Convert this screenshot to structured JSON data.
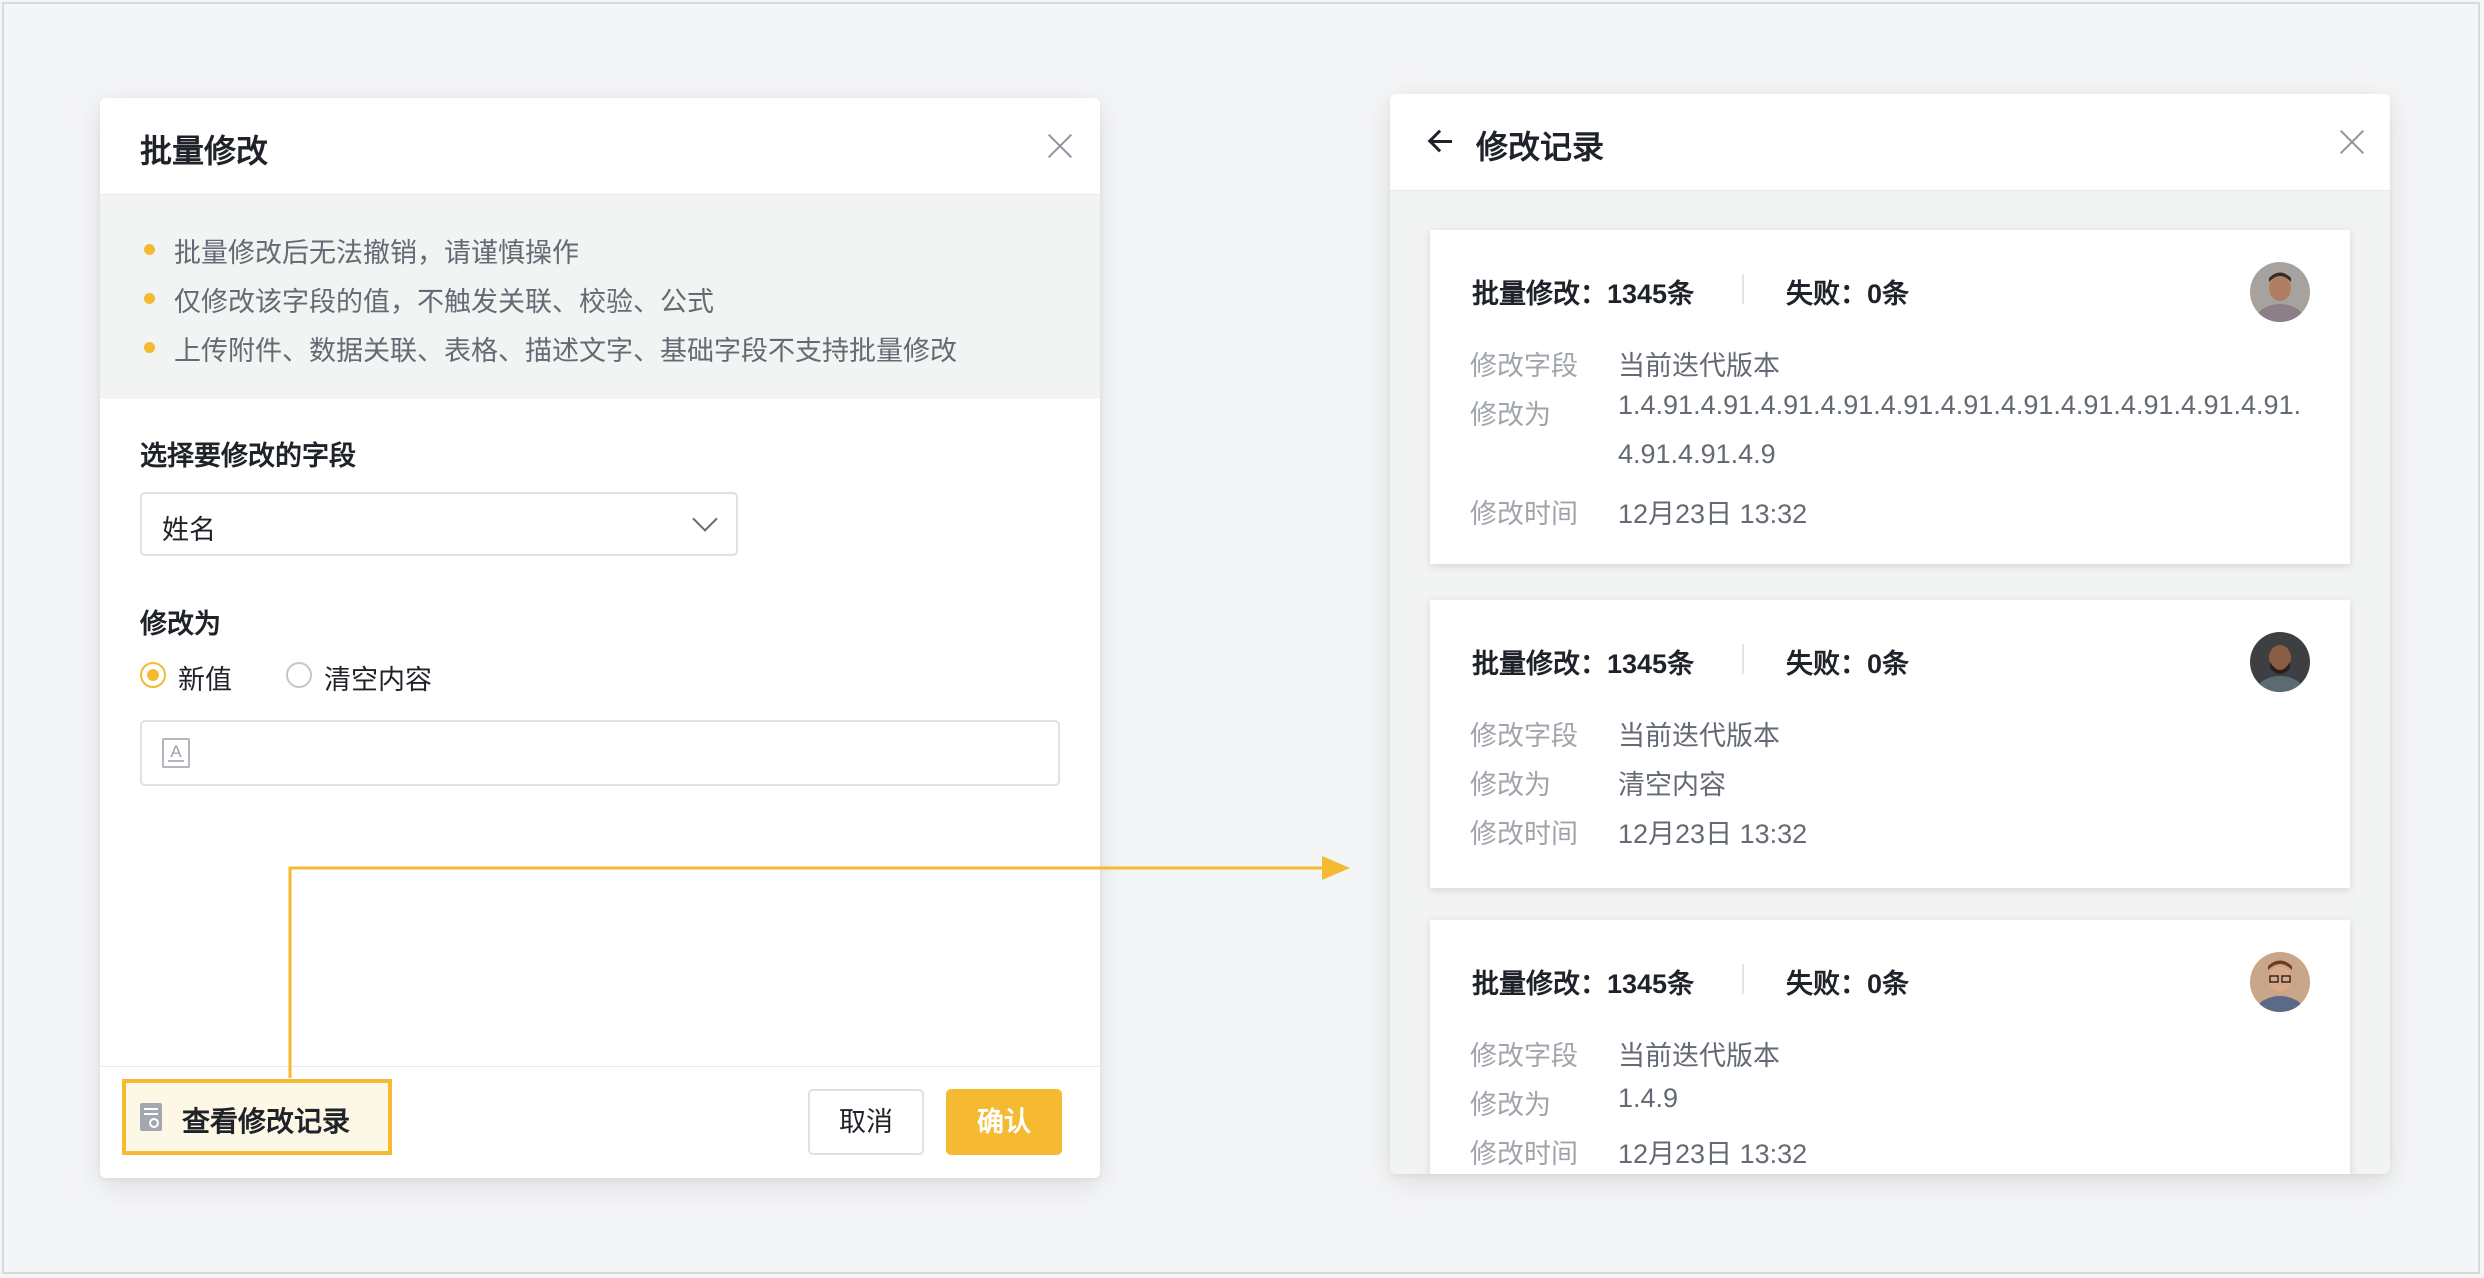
{
  "batch_dialog": {
    "title": "批量修改",
    "tips": [
      "批量修改后无法撤销，请谨慎操作",
      "仅修改该字段的值，不触发关联、校验、公式",
      "上传附件、数据关联、表格、描述文字、基础字段不支持批量修改"
    ],
    "field_label": "选择要修改的字段",
    "field_value": "姓名",
    "modify_to_label": "修改为",
    "options": [
      {
        "label": "新值",
        "checked": true
      },
      {
        "label": "清空内容",
        "checked": false
      }
    ],
    "new_value_input": "",
    "history_button": "查看修改记录",
    "cancel_button": "取消",
    "confirm_button": "确认"
  },
  "history_panel": {
    "title": "修改记录",
    "field_key": "修改字段",
    "value_key": "修改为",
    "time_key": "修改时间",
    "records": [
      {
        "batch": "批量修改：1345条",
        "failed": "失败：0条",
        "field": "当前迭代版本",
        "value": "1.4.91.4.91.4.91.4.91.4.91.4.91.4.91.4.91.4.91.4.91.4.91.4.91.4.91.4.9",
        "time": "12月23日 13:32",
        "avatar": "avatar-man-light-shirt"
      },
      {
        "batch": "批量修改：1345条",
        "failed": "失败：0条",
        "field": "当前迭代版本",
        "value": "清空内容",
        "time": "12月23日 13:32",
        "avatar": "avatar-man-beard"
      },
      {
        "batch": "批量修改：1345条",
        "failed": "失败：0条",
        "field": "当前迭代版本",
        "value": "1.4.9",
        "time": "12月23日 13:32",
        "avatar": "avatar-man-glasses"
      }
    ]
  },
  "colors": {
    "accent": "#f5b932",
    "accent_soft": "#fdf7e6",
    "text": "#1f2329",
    "muted": "#646a73",
    "faint": "#a0a4ab"
  }
}
